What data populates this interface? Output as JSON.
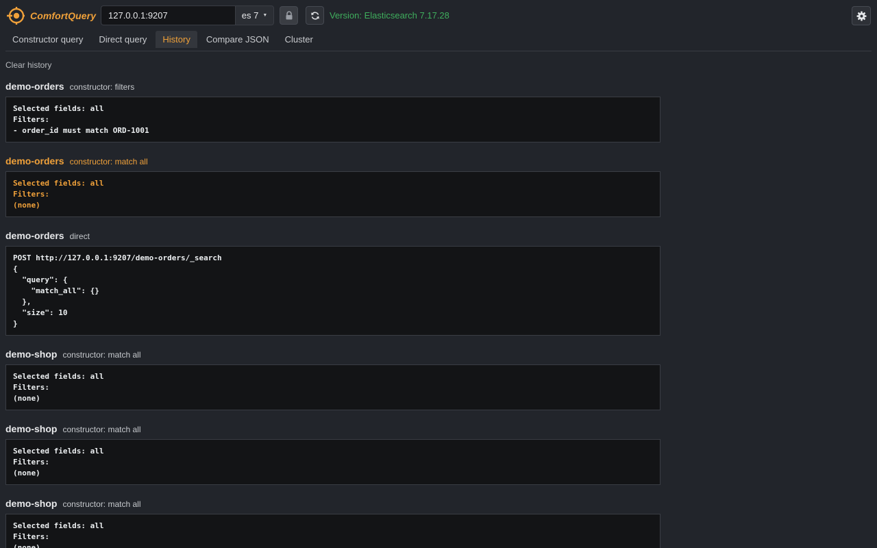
{
  "app": {
    "name": "ComfortQuery",
    "host": "127.0.0.1:9207",
    "es_version_option": "es 7",
    "version_label": "Version: Elasticsearch 7.17.28"
  },
  "tabs": [
    {
      "label": "Constructor query",
      "active": false
    },
    {
      "label": "Direct query",
      "active": false
    },
    {
      "label": "History",
      "active": true
    },
    {
      "label": "Compare JSON",
      "active": false
    },
    {
      "label": "Cluster",
      "active": false
    }
  ],
  "clear_history_label": "Clear history",
  "history": [
    {
      "index": "demo-orders",
      "type": "constructor: filters",
      "body": "Selected fields: all\nFilters:\n- order_id must match ORD-1001",
      "highlight": false
    },
    {
      "index": "demo-orders",
      "type": "constructor: match all",
      "body": "Selected fields: all\nFilters:\n(none)",
      "highlight": true
    },
    {
      "index": "demo-orders",
      "type": "direct",
      "body": "POST http://127.0.0.1:9207/demo-orders/_search\n{\n  \"query\": {\n    \"match_all\": {}\n  },\n  \"size\": 10\n}",
      "highlight": false
    },
    {
      "index": "demo-shop",
      "type": "constructor: match all",
      "body": "Selected fields: all\nFilters:\n(none)",
      "highlight": false
    },
    {
      "index": "demo-shop",
      "type": "constructor: match all",
      "body": "Selected fields: all\nFilters:\n(none)",
      "highlight": false
    },
    {
      "index": "demo-shop",
      "type": "constructor: match all",
      "body": "Selected fields: all\nFilters:\n(none)",
      "highlight": false
    }
  ],
  "colors": {
    "accent": "#f0a13a",
    "version_green": "#3fae5d",
    "background": "#22252b"
  },
  "icons": {
    "logo": "target-logo-icon",
    "lock": "lock-icon",
    "refresh": "refresh-icon",
    "settings": "gear-icon",
    "dropdown": "caret-down-icon"
  }
}
